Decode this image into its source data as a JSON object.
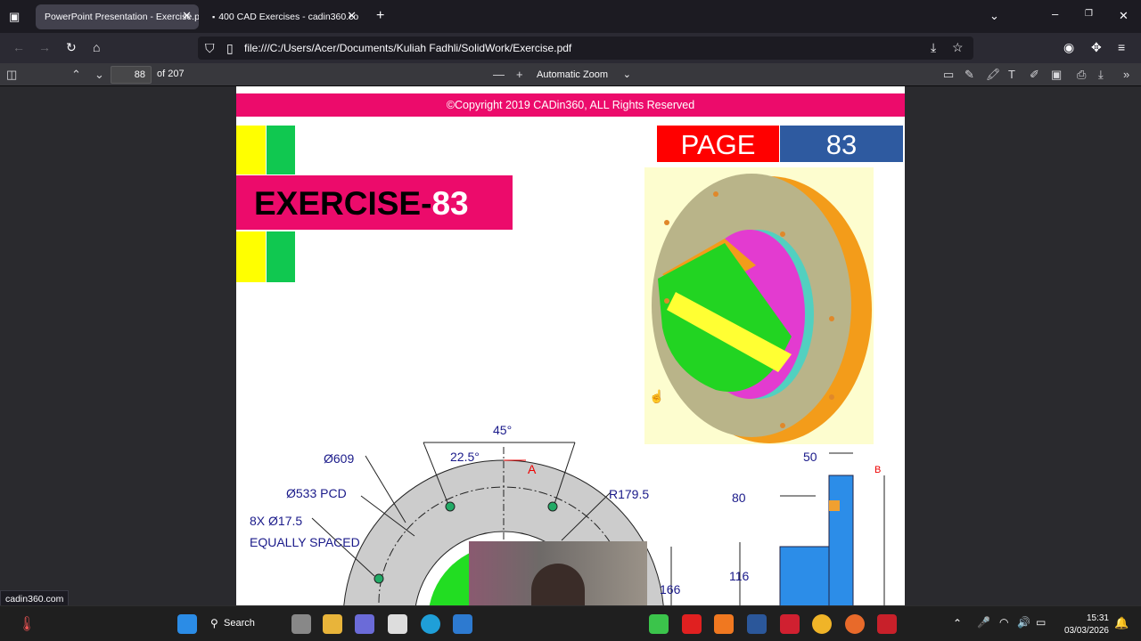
{
  "browser": {
    "tabs": [
      {
        "label": "PowerPoint Presentation - Exercise.p",
        "active": true
      },
      {
        "label": "400 CAD Exercises - cadin360.co",
        "active": false
      }
    ],
    "url": "file:///C:/Users/Acer/Documents/Kuliah Fadhli/SolidWork/Exercise.pdf",
    "status_link": "cadin360.com"
  },
  "pdf_toolbar": {
    "page_number": "88",
    "page_count": "of 207",
    "zoom": "Automatic Zoom"
  },
  "document": {
    "copyright": "©Copyright 2019 CADin360, ALL Rights Reserved",
    "page_label": "PAGE",
    "page_value": "83",
    "exercise_label": "EXERCISE-",
    "exercise_number": "83",
    "dimensions": {
      "d609": "Ø609",
      "d533": "Ø533 PCD",
      "holes": "8X Ø17.5",
      "spaced": "EQUALLY SPACED",
      "angle45": "45°",
      "angle225": "22.5°",
      "section_a": "A",
      "r1795": "R179.5",
      "v50": "50",
      "v80": "80",
      "v116": "116",
      "v166": "166",
      "detail_b": "B"
    }
  },
  "taskbar": {
    "search": "Search",
    "time": "15:31",
    "date": "03/03/2026"
  },
  "colors": {
    "magenta": "#ec0b6b",
    "red": "#ff0000",
    "blue": "#2e5aa0",
    "yellow": "#ffff00",
    "green": "#10c850"
  }
}
